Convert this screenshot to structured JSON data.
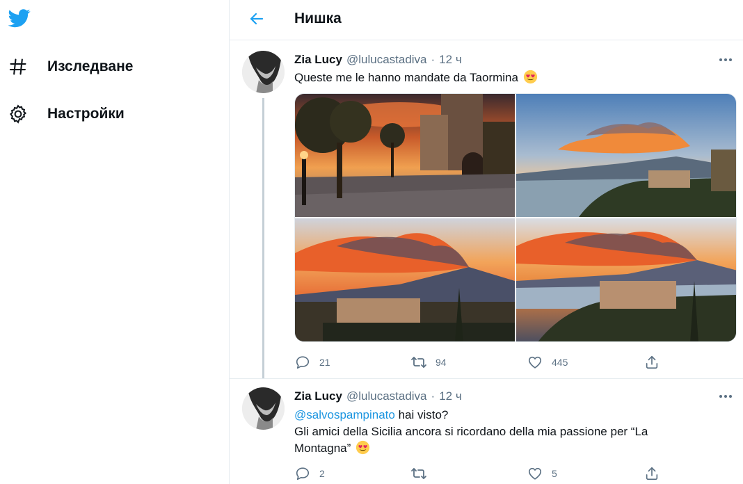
{
  "sidebar": {
    "logo": "twitter-bird-icon",
    "items": [
      {
        "label": "Изследване",
        "icon": "hashtag-icon"
      },
      {
        "label": "Настройки",
        "icon": "gear-icon"
      }
    ]
  },
  "header": {
    "title": "Нишка",
    "back_icon": "arrow-left-icon"
  },
  "tweets": [
    {
      "name": "Zia Lucy",
      "handle": "@lulucastadiva",
      "separator": "·",
      "time": "12 ч",
      "text": "Queste me le hanno mandate da Taormina",
      "emoji": "heart-eyes-emoji",
      "photos": [
        "photo-taormina-square",
        "photo-etna-coast",
        "photo-etna-sunset-clouds",
        "photo-etna-town-view"
      ],
      "replies": "21",
      "retweets": "94",
      "likes": "445"
    },
    {
      "name": "Zia Lucy",
      "handle": "@lulucastadiva",
      "separator": "·",
      "time": "12 ч",
      "mention": "@salvospampinato",
      "line1_rest": " hai visto?",
      "line2": "Gli amici della Sicilia ancora si ricordano della mia passione per “La",
      "line3": "Montagna”",
      "emoji": "heart-eyes-emoji",
      "replies": "2",
      "retweets": "",
      "likes": "5"
    }
  ],
  "colors": {
    "accent": "#1da1f2",
    "text": "#0f1419",
    "secondary": "#5b7083",
    "border": "#e6ecf0"
  }
}
